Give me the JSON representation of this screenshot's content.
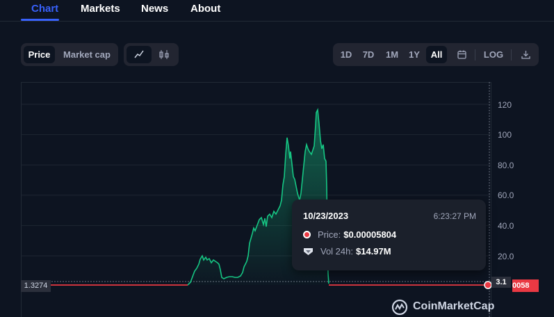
{
  "nav": {
    "items": [
      "Chart",
      "Markets",
      "News",
      "About"
    ],
    "active": "Chart",
    "accent": "#3861fb"
  },
  "toolbar": {
    "price_label": "Price",
    "market_cap_label": "Market cap",
    "line_icon": "line-chart-icon",
    "candle_icon": "candlestick-icon",
    "ranges": [
      "1D",
      "7D",
      "1M",
      "1Y",
      "All"
    ],
    "active_range": "All",
    "calendar_icon": "calendar-icon",
    "log_label": "LOG",
    "download_icon": "download-icon"
  },
  "chart_data": {
    "type": "area",
    "y_axis_ticks": [
      "20.0",
      "40.0",
      "60.0",
      "80.0",
      "100",
      "120"
    ],
    "ylim": [
      0,
      130
    ],
    "grid": true,
    "line_color_up": "#16c784",
    "line_color_down": "#ea3943",
    "left_badge": "1.3274",
    "price_badge": "0058",
    "volume_badge": "3.1"
  },
  "tooltip": {
    "date": "10/23/2023",
    "time": "6:23:27 PM",
    "price_label": "Price:",
    "price_value": "$0.00005804",
    "vol_label": "Vol 24h:",
    "vol_value": "$14.97M"
  },
  "brand": {
    "name": "CoinMarketCap"
  }
}
